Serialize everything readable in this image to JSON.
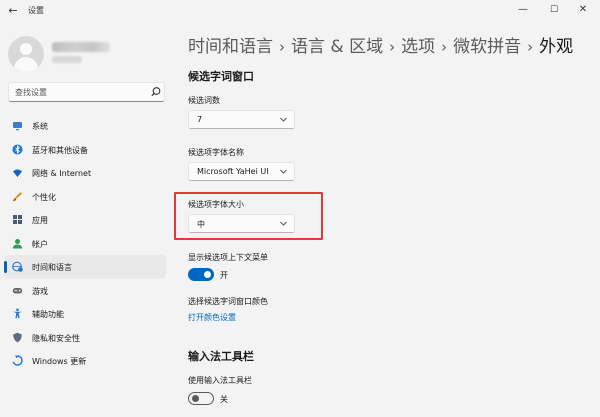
{
  "window": {
    "back_glyph": "←",
    "title": "设置",
    "minimize_glyph": "—",
    "maximize_glyph": "☐",
    "close_glyph": "✕"
  },
  "sidebar": {
    "search_placeholder": "查找设置",
    "items": [
      {
        "label": "系统",
        "icon": "monitor-icon",
        "color": "#3a7bd5"
      },
      {
        "label": "蓝牙和其他设备",
        "icon": "bluetooth-icon",
        "color": "#1976d2"
      },
      {
        "label": "网络 & Internet",
        "icon": "wifi-icon",
        "color": "#1565c0"
      },
      {
        "label": "个性化",
        "icon": "brush-icon",
        "color": "#e0902b"
      },
      {
        "label": "应用",
        "icon": "apps-icon",
        "color": "#4a5a73"
      },
      {
        "label": "帐户",
        "icon": "person-icon",
        "color": "#2e9e5a"
      },
      {
        "label": "时间和语言",
        "icon": "globe-clock-icon",
        "color": "#1f7ad0"
      },
      {
        "label": "游戏",
        "icon": "gamepad-icon",
        "color": "#6b6b6b"
      },
      {
        "label": "辅助功能",
        "icon": "accessibility-icon",
        "color": "#1f7ad0"
      },
      {
        "label": "隐私和安全性",
        "icon": "shield-icon",
        "color": "#5f6b7a"
      },
      {
        "label": "Windows 更新",
        "icon": "update-icon",
        "color": "#1f7ad0"
      }
    ],
    "active_index": 6
  },
  "breadcrumb": {
    "items": [
      "时间和语言",
      "语言 & 区域",
      "选项",
      "微软拼音"
    ],
    "current": "外观",
    "separator": "›"
  },
  "candidate_window": {
    "title": "候选字词窗口",
    "count_label": "候选词数",
    "count_value": "7",
    "font_name_label": "候选项字体名称",
    "font_name_value": "Microsoft YaHei UI",
    "font_size_label": "候选项字体大小",
    "font_size_value": "中",
    "context_menu_label": "显示候选项上下文菜单",
    "context_menu_state": "开",
    "color_label": "选择候选字词窗口颜色",
    "color_link": "打开颜色设置"
  },
  "ime_toolbar": {
    "title": "输入法工具栏",
    "use_label": "使用输入法工具栏",
    "use_state": "关"
  },
  "colors": {
    "accent": "#0067c0",
    "highlight": "#e8373b"
  }
}
